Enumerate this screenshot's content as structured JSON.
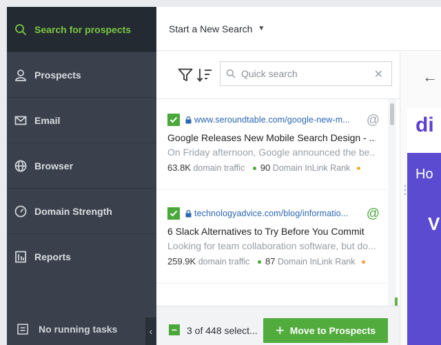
{
  "sidebar": {
    "items": [
      {
        "label": "Search for prospects",
        "icon": "search-icon",
        "active": true
      },
      {
        "label": "Prospects",
        "icon": "user-icon"
      },
      {
        "label": "Email",
        "icon": "envelope-icon"
      },
      {
        "label": "Browser",
        "icon": "globe-icon"
      },
      {
        "label": "Domain Strength",
        "icon": "gauge-icon"
      },
      {
        "label": "Reports",
        "icon": "report-icon"
      }
    ],
    "footer": {
      "label": "No running tasks",
      "collapse": "‹"
    }
  },
  "topbar": {
    "title": "Start a New Search"
  },
  "toolbar": {
    "search_placeholder": "Quick search"
  },
  "results": [
    {
      "url": "www.seroundtable.com/google-new-m...",
      "title": "Google Releases New Mobile Search Design - ...",
      "description": "On Friday afternoon, Google announced the be...",
      "traffic": "63.8K",
      "traffic_label": "domain traffic",
      "inlink_rank": "90",
      "inlink_label": "Domain InLink Rank",
      "email_found": false
    },
    {
      "url": "technologyadvice.com/blog/informatio...",
      "title": "6 Slack Alternatives to Try Before You Commit",
      "description": "Looking for team collaboration software, but do...",
      "traffic": "259.9K",
      "traffic_label": "domain traffic",
      "inlink_rank": "87",
      "inlink_label": "Domain InLink Rank",
      "email_found": true
    }
  ],
  "footer": {
    "selection": "3 of 448 select...",
    "move_button": "Move to Prospects"
  },
  "preview": {
    "logo_text": "di",
    "band_text": "Ho",
    "band_letter": "V"
  },
  "colors": {
    "accent_green": "#7ac943",
    "button_green": "#52ab3d",
    "sidebar_bg": "#3a414c",
    "link_blue": "#2a66b2"
  }
}
